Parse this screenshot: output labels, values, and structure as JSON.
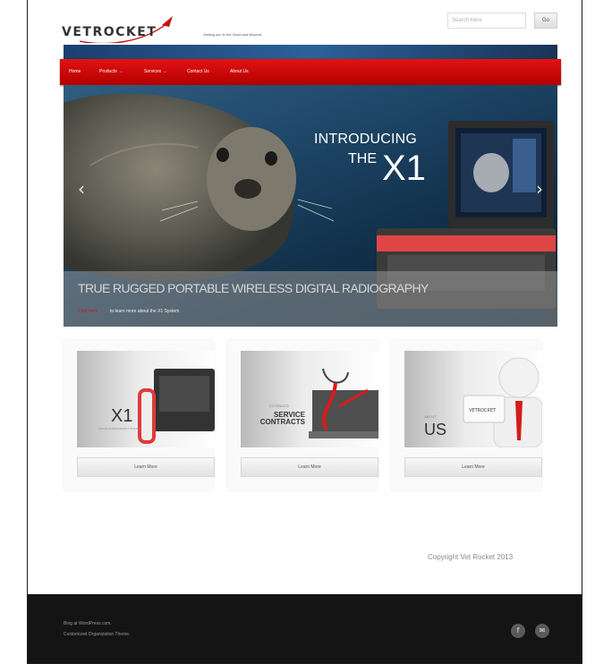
{
  "header": {
    "logo_text": "VETROCKET",
    "tagline": "Getting you to the Good and Beyond",
    "search_placeholder": "Search Here",
    "search_button": "Go"
  },
  "nav": {
    "items": [
      {
        "label": "Home"
      },
      {
        "label": "Products →"
      },
      {
        "label": "Services →"
      },
      {
        "label": "Contact Us"
      },
      {
        "label": "About Us"
      }
    ]
  },
  "hero": {
    "intro": "INTRODUCING",
    "the": "THE",
    "product": "X1",
    "headline": "TRUE RUGGED PORTABLE WIRELESS DIGITAL RADIOGRAPHY",
    "link_text": "Click here",
    "link_rest": "to learn more about the X1 System",
    "prev_icon": "‹",
    "next_icon": "›"
  },
  "features": [
    {
      "small": "Digital Radiography System",
      "big": "X1",
      "button": "Learn More"
    },
    {
      "small": "Extended",
      "big": "SERVICE CONTRACTS",
      "button": "Learn More"
    },
    {
      "small": "About",
      "big": "US",
      "button": "Learn More"
    }
  ],
  "copyright": "Copyright Vet Rocket 2013",
  "footer": {
    "line1": "Blog at WordPress.com.",
    "line2": "Customized Organization Theme.",
    "facebook_glyph": "f",
    "email_glyph": "✉"
  },
  "colors": {
    "nav_red": "#d60000",
    "accent_red": "#d01616",
    "footer_bg": "#141414"
  }
}
